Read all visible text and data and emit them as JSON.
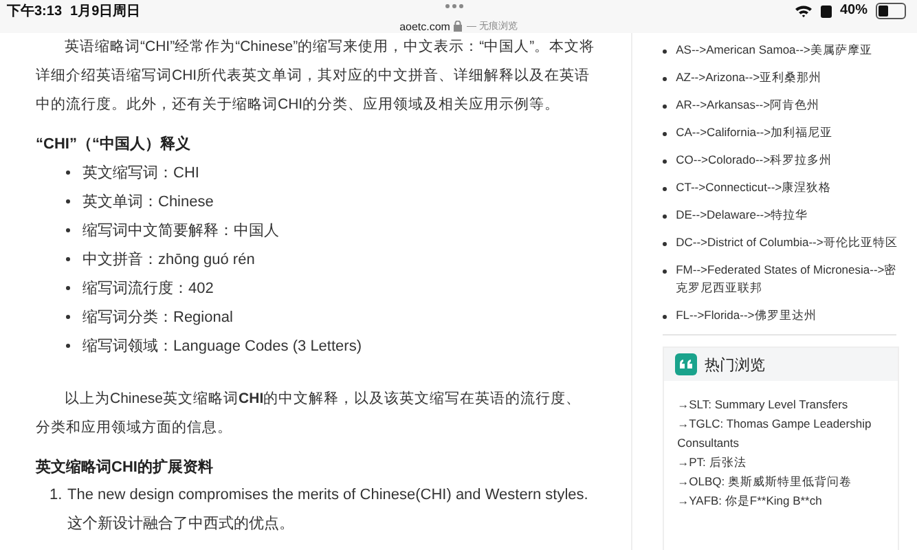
{
  "status_bar": {
    "time": "下午3:13",
    "date": "1月9日周日",
    "battery": "40%"
  },
  "address_bar": {
    "domain": "aoetc.com",
    "mode": "— 无痕浏览"
  },
  "article": {
    "intro": "英语缩略词“CHI”经常作为“Chinese”的缩写来使用，中文表示：“中国人”。本文将详细介绍英语缩写词CHI所代表英文单词，其对应的中文拼音、详细解释以及在英语中的流行度。此外，还有关于缩略词CHI的分类、应用领域及相关应用示例等。",
    "definition_heading": "“CHI”（“中国人）释义",
    "definitions": [
      "英文缩写词：CHI",
      "英文单词：Chinese",
      "缩写词中文简要解释：中国人",
      "中文拼音：zhōng guó rén",
      "缩写词流行度：402",
      "缩写词分类：Regional",
      "缩写词领域：Language Codes (3 Letters)"
    ],
    "summary": "以上为Chinese英文缩略词**CHI**的中文解释，以及该英文缩写在英语的流行度、分类和应用领域方面的信息。",
    "extended_heading": "英文缩略词CHI的扩展资料",
    "examples": [
      {
        "number": "1.",
        "sentence": "The new design compromises the merits of Chinese(CHI) and Western styles.",
        "translation": "这个新设计融合了中西式的优点。"
      }
    ]
  },
  "sidebar": {
    "states": [
      "AS-->American Samoa-->美属萨摩亚",
      "AZ-->Arizona-->亚利桑那州",
      "AR-->Arkansas-->阿肯色州",
      "CA-->California-->加利福尼亚",
      "CO-->Colorado-->科罗拉多州",
      "CT-->Connecticut-->康涅狄格",
      "DE-->Delaware-->特拉华",
      "DC-->District of Columbia-->哥伦比亚特区",
      "FM-->Federated States of Micronesia-->密克罗尼西亚联邦",
      "FL-->Florida-->佛罗里达州"
    ],
    "popular": {
      "title": "热门浏览",
      "items": [
        "→SLT: Summary Level Transfers",
        "→TGLC: Thomas Gampe Leadership Consultants",
        "→PT: 后张法",
        "→OLBQ: 奥斯威斯特里低背问卷",
        "→YAFB: 你是F**King B**ch"
      ]
    }
  }
}
